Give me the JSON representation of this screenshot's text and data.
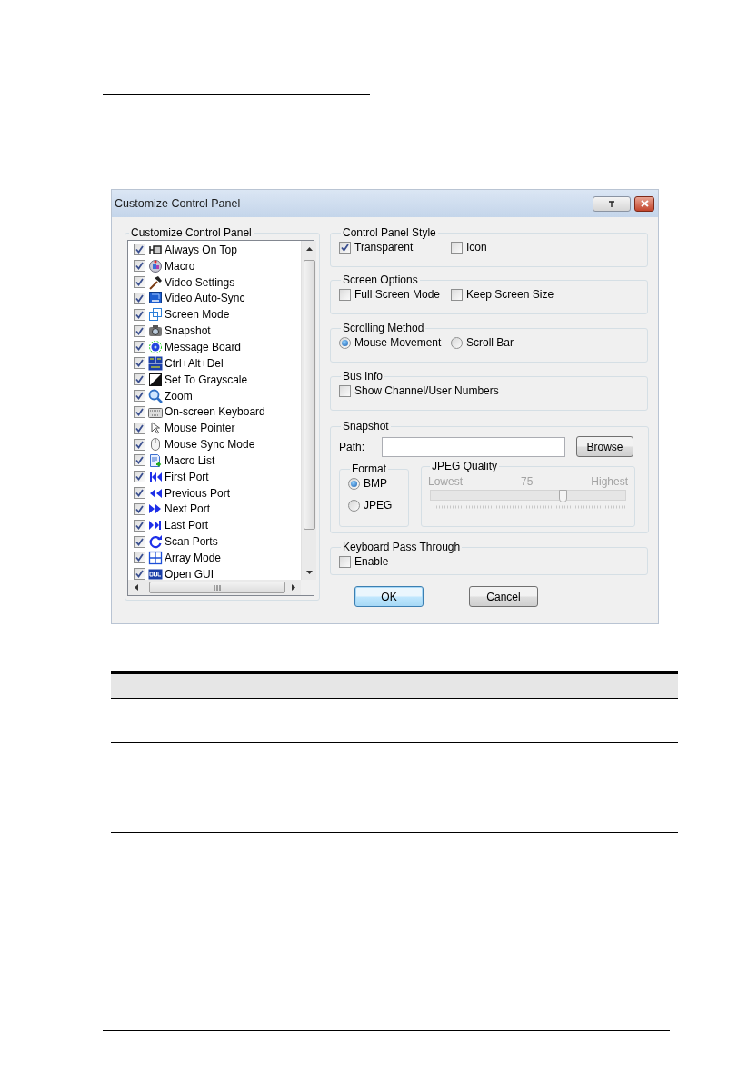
{
  "dialog": {
    "title": "Customize Control Panel",
    "feature_list": {
      "title": "Customize Control Panel",
      "items": [
        {
          "label": "Always On Top",
          "checked": true
        },
        {
          "label": "Macro",
          "checked": true
        },
        {
          "label": "Video Settings",
          "checked": true
        },
        {
          "label": "Video Auto-Sync",
          "checked": true
        },
        {
          "label": "Screen Mode",
          "checked": true
        },
        {
          "label": "Snapshot",
          "checked": true
        },
        {
          "label": "Message Board",
          "checked": true
        },
        {
          "label": "Ctrl+Alt+Del",
          "checked": true
        },
        {
          "label": "Set To Grayscale",
          "checked": true
        },
        {
          "label": "Zoom",
          "checked": true
        },
        {
          "label": "On-screen Keyboard",
          "checked": true
        },
        {
          "label": "Mouse Pointer",
          "checked": true
        },
        {
          "label": "Mouse Sync Mode",
          "checked": true
        },
        {
          "label": "Macro List",
          "checked": true
        },
        {
          "label": "First Port",
          "checked": true
        },
        {
          "label": "Previous Port",
          "checked": true
        },
        {
          "label": "Next Port",
          "checked": true
        },
        {
          "label": "Last Port",
          "checked": true
        },
        {
          "label": "Scan Ports",
          "checked": true
        },
        {
          "label": "Array Mode",
          "checked": true
        },
        {
          "label": "Open GUI",
          "checked": true
        }
      ]
    },
    "sections": [
      {
        "kind": "checkboxes",
        "title": "Control Panel Style",
        "options": [
          {
            "label": "Transparent",
            "checked": true
          },
          {
            "label": "Icon",
            "checked": false
          }
        ]
      },
      {
        "kind": "checkboxes",
        "title": "Screen Options",
        "options": [
          {
            "label": "Full Screen Mode",
            "checked": false
          },
          {
            "label": "Keep Screen Size",
            "checked": false
          }
        ]
      },
      {
        "kind": "radios",
        "title": "Scrolling Method",
        "options": [
          {
            "label": "Mouse Movement",
            "selected": true
          },
          {
            "label": "Scroll Bar",
            "selected": false
          }
        ]
      },
      {
        "kind": "checkboxes",
        "title": "Bus Info",
        "options": [
          {
            "label": "Show Channel/User Numbers",
            "checked": false
          }
        ]
      },
      {
        "kind": "snapshot",
        "title": "Snapshot",
        "path_label": "Path:",
        "browse_button": "Browse",
        "format": {
          "title": "Format",
          "options": [
            {
              "label": "BMP",
              "selected": true
            },
            {
              "label": "JPEG",
              "selected": false
            }
          ]
        },
        "jpeg_quality": {
          "title": "JPEG Quality",
          "disabled": true,
          "min_label": "Lowest",
          "value_label": "75",
          "max_label": "Highest",
          "level": 0.68
        }
      },
      {
        "kind": "checkboxes",
        "title": "Keyboard Pass Through",
        "options": [
          {
            "label": "Enable",
            "checked": false
          }
        ]
      }
    ],
    "buttons": [
      {
        "label": "OK",
        "default": true
      },
      {
        "label": "Cancel",
        "default": false
      }
    ]
  }
}
